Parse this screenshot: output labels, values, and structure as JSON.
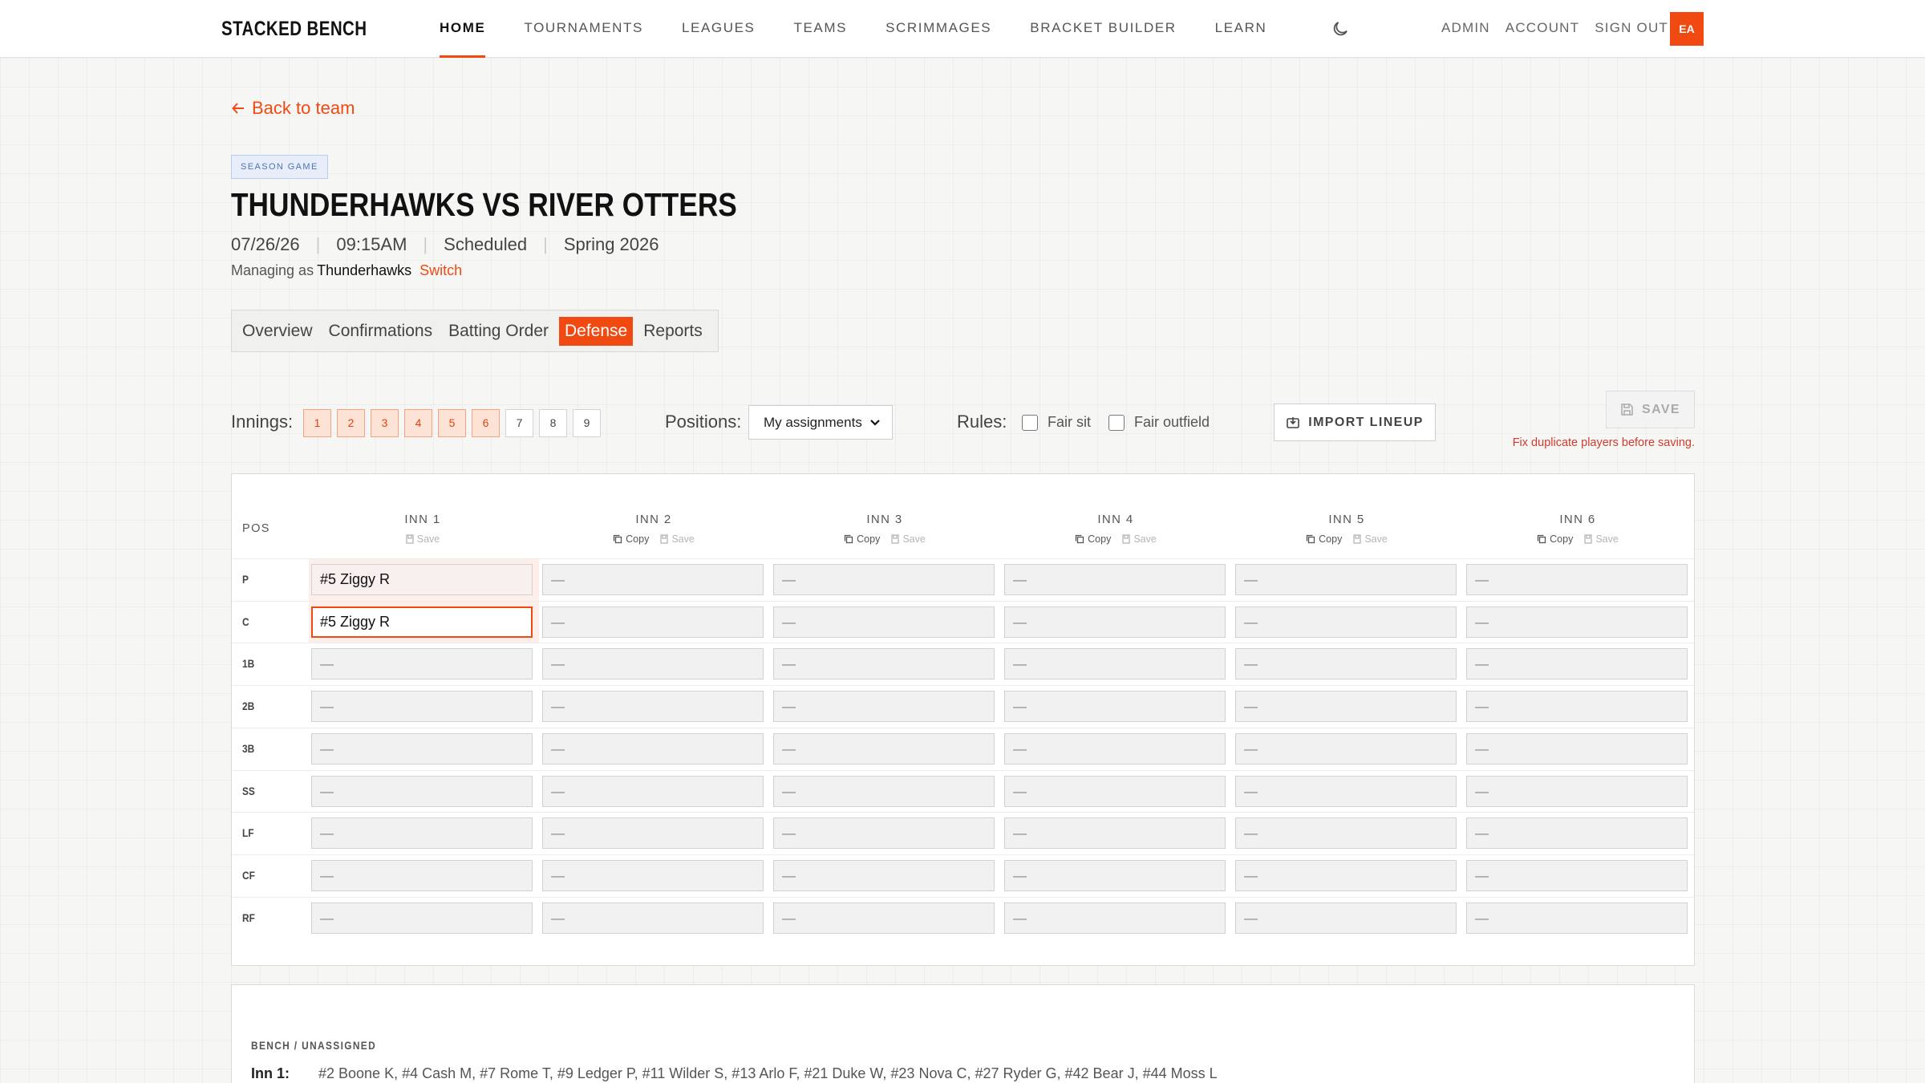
{
  "nav": {
    "brand": "STACKED BENCH",
    "links": [
      "HOME",
      "TOURNAMENTS",
      "LEAGUES",
      "TEAMS",
      "SCRIMMAGES",
      "BRACKET BUILDER",
      "LEARN"
    ],
    "active_link": "HOME",
    "right_links": [
      "ADMIN",
      "ACCOUNT",
      "SIGN OUT"
    ],
    "avatar_initials": "EA"
  },
  "header": {
    "back_label": "Back to team",
    "badge": "SEASON GAME",
    "title": "THUNDERHAWKS VS RIVER OTTERS",
    "date": "07/26/26",
    "time": "09:15AM",
    "status": "Scheduled",
    "season": "Spring 2026",
    "managing_prefix": "Managing as",
    "managing_team": "Thunderhawks",
    "switch_label": "Switch"
  },
  "tabs": [
    "Overview",
    "Confirmations",
    "Batting Order",
    "Defense",
    "Reports"
  ],
  "active_tab": "Defense",
  "controls": {
    "innings_label": "Innings:",
    "innings": [
      "1",
      "2",
      "3",
      "4",
      "5",
      "6",
      "7",
      "8",
      "9"
    ],
    "innings_selected": 6,
    "positions_label": "Positions:",
    "positions_value": "My assignments",
    "rules_label": "Rules:",
    "fair_sit": "Fair sit",
    "fair_outfield": "Fair outfield",
    "import_label": "IMPORT LINEUP",
    "save_label": "SAVE",
    "error": "Fix duplicate players before saving."
  },
  "grid": {
    "pos_header": "POS",
    "copy_label": "Copy",
    "save_label": "Save",
    "columns": [
      "INN 1",
      "INN 2",
      "INN 3",
      "INN 4",
      "INN 5",
      "INN 6"
    ],
    "positions": [
      "P",
      "C",
      "1B",
      "2B",
      "3B",
      "SS",
      "LF",
      "CF",
      "RF"
    ],
    "empty": "—",
    "assignments": {
      "P": {
        "0": "#5 Ziggy R"
      },
      "C": {
        "0": "#5 Ziggy R"
      }
    }
  },
  "bench": {
    "title": "BENCH / UNASSIGNED",
    "rows": [
      {
        "label": "Inn 1:",
        "players": "#2 Boone K, #4 Cash M, #7 Rome T, #9 Ledger P, #11 Wilder S, #13 Arlo F, #21 Duke W, #23 Nova C, #27 Ryder G, #42 Bear J, #44 Moss L"
      }
    ]
  },
  "colors": {
    "accent": "#f04a12",
    "error": "#d03b2e",
    "badge": "#4c73b5"
  }
}
